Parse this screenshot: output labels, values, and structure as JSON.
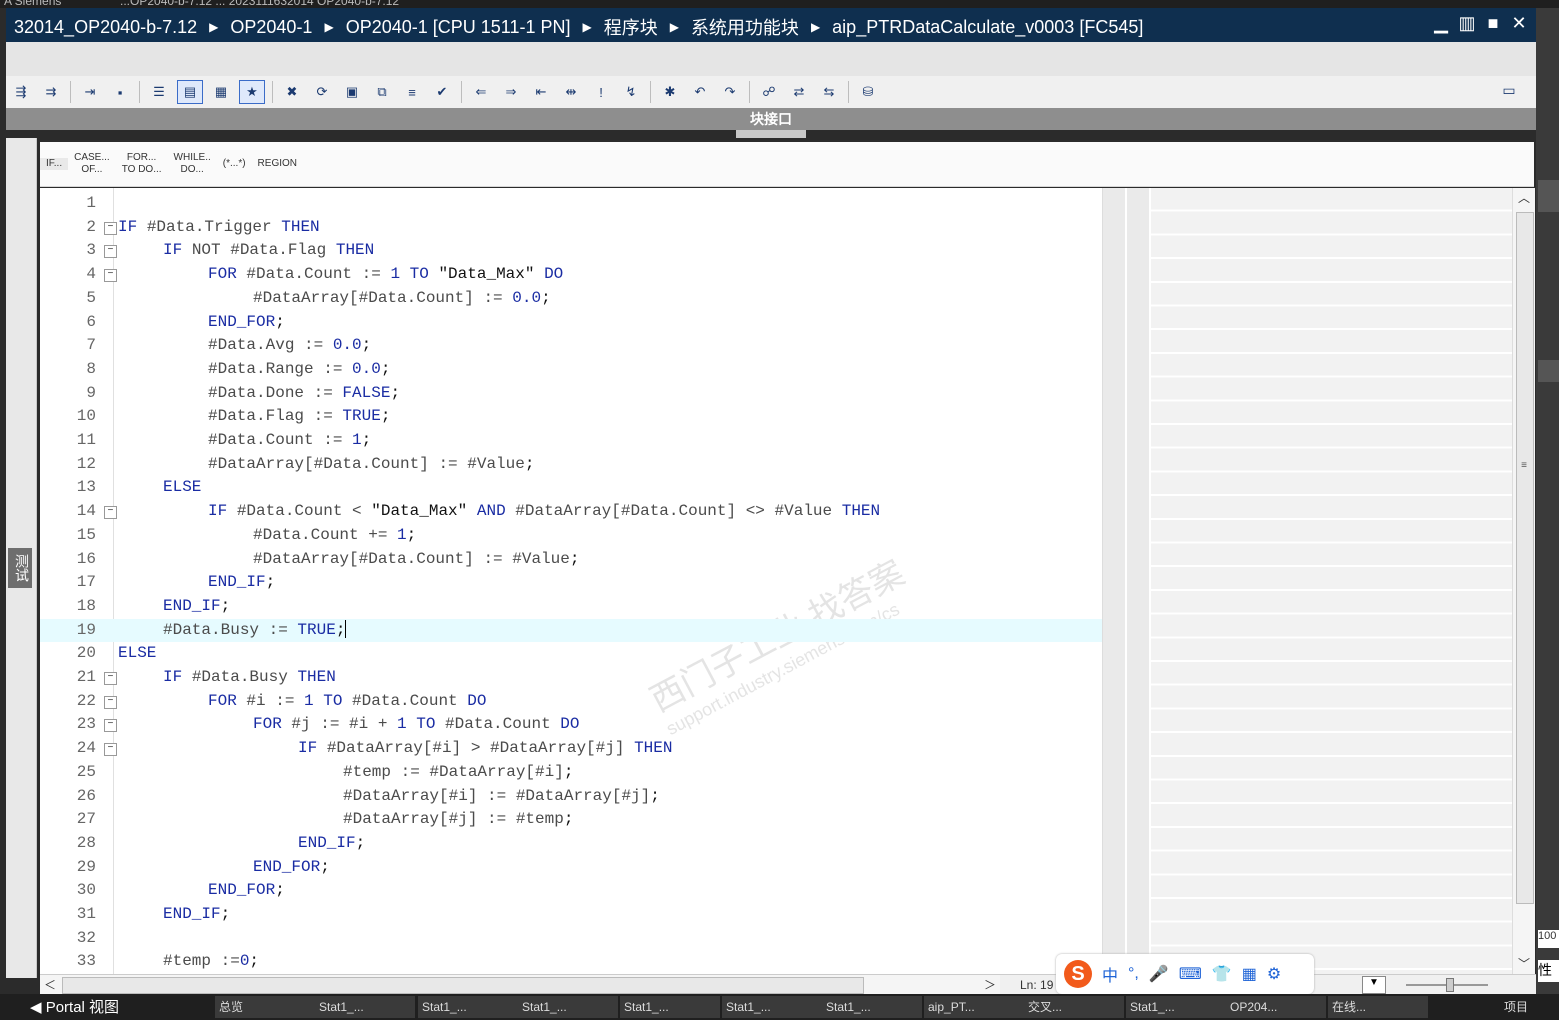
{
  "top_strip": {
    "left": "A Siemens",
    "middle": "...OP2040-b-7.12 ... 2023111632014 OP2040-b-7.12"
  },
  "breadcrumb": [
    "32014_OP2040-b-7.12",
    "OP2040-1",
    "OP2040-1 [CPU 1511-1 PN]",
    "程序块",
    "系统用功能块",
    "aip_PTRDataCalculate_v0003 [FC545]"
  ],
  "window_controls": [
    "minimize",
    "tile",
    "maximize",
    "close"
  ],
  "toolbar_icons": [
    "insert-network-icon",
    "delete-network-icon",
    "call-icon",
    "open-block-icon",
    "absolute-address-icon",
    "toggle-view-icon",
    "monitor-icon",
    "favorites-icon",
    "clear-breakpoint-icon",
    "set-breakpoint-icon",
    "step-icon",
    "run-icon",
    "comment-icon",
    "check-icon",
    "indent-left-icon",
    "indent-right-icon",
    "outdent-icon",
    "auto-format-icon",
    "line-comment-icon",
    "uncomment-icon",
    "bookmark-icon",
    "prev-bookmark-icon",
    "next-bookmark-icon",
    "diagnostics-icon",
    "go-to-icon",
    "go-back-icon",
    "settings-icon"
  ],
  "interface_label": "块接口",
  "snippets": [
    {
      "line1": "IF...",
      "line2": ""
    },
    {
      "line1": "CASE...",
      "line2": "OF..."
    },
    {
      "line1": "FOR...",
      "line2": "TO DO..."
    },
    {
      "line1": "WHILE..",
      "line2": "DO..."
    },
    {
      "line1": "(*...*)",
      "line2": ""
    },
    {
      "line1": "REGION",
      "line2": ""
    }
  ],
  "left_tab_label": "测试",
  "code_lines": [
    {
      "n": "1",
      "indent": 0,
      "fold": false,
      "tokens": []
    },
    {
      "n": "2",
      "indent": 0,
      "fold": true,
      "tokens": [
        [
          "kw",
          "IF "
        ],
        [
          "var",
          "#Data.Trigger "
        ],
        [
          "kw",
          "THEN"
        ]
      ]
    },
    {
      "n": "3",
      "indent": 1,
      "fold": true,
      "tokens": [
        [
          "kw",
          "IF "
        ],
        [
          "var",
          "NOT #Data.Flag "
        ],
        [
          "kw",
          "THEN"
        ]
      ]
    },
    {
      "n": "4",
      "indent": 2,
      "fold": true,
      "tokens": [
        [
          "kw",
          "FOR "
        ],
        [
          "var",
          "#Data.Count := "
        ],
        [
          "num",
          "1 "
        ],
        [
          "kw",
          "TO "
        ],
        [
          "str",
          "\"Data_Max\" "
        ],
        [
          "kw",
          "DO"
        ]
      ]
    },
    {
      "n": "5",
      "indent": 3,
      "fold": false,
      "tokens": [
        [
          "var",
          "#DataArray[#Data.Count] := "
        ],
        [
          "num",
          "0.0"
        ],
        [
          "str",
          ";"
        ]
      ]
    },
    {
      "n": "6",
      "indent": 2,
      "fold": false,
      "tokens": [
        [
          "kw",
          "END_FOR"
        ],
        [
          "str",
          ";"
        ]
      ]
    },
    {
      "n": "7",
      "indent": 2,
      "fold": false,
      "tokens": [
        [
          "var",
          "#Data.Avg := "
        ],
        [
          "num",
          "0.0"
        ],
        [
          "str",
          ";"
        ]
      ]
    },
    {
      "n": "8",
      "indent": 2,
      "fold": false,
      "tokens": [
        [
          "var",
          "#Data.Range := "
        ],
        [
          "num",
          "0.0"
        ],
        [
          "str",
          ";"
        ]
      ]
    },
    {
      "n": "9",
      "indent": 2,
      "fold": false,
      "tokens": [
        [
          "var",
          "#Data.Done := "
        ],
        [
          "kw",
          "FALSE"
        ],
        [
          "str",
          ";"
        ]
      ]
    },
    {
      "n": "10",
      "indent": 2,
      "fold": false,
      "tokens": [
        [
          "var",
          "#Data.Flag := "
        ],
        [
          "kw",
          "TRUE"
        ],
        [
          "str",
          ";"
        ]
      ]
    },
    {
      "n": "11",
      "indent": 2,
      "fold": false,
      "tokens": [
        [
          "var",
          "#Data.Count := "
        ],
        [
          "num",
          "1"
        ],
        [
          "str",
          ";"
        ]
      ]
    },
    {
      "n": "12",
      "indent": 2,
      "fold": false,
      "tokens": [
        [
          "var",
          "#DataArray[#Data.Count] := #Value"
        ],
        [
          "str",
          ";"
        ]
      ]
    },
    {
      "n": "13",
      "indent": 1,
      "fold": false,
      "tokens": [
        [
          "kw",
          "ELSE"
        ]
      ]
    },
    {
      "n": "14",
      "indent": 2,
      "fold": true,
      "tokens": [
        [
          "kw",
          "IF "
        ],
        [
          "var",
          "#Data.Count < "
        ],
        [
          "str",
          "\"Data_Max\" "
        ],
        [
          "kw",
          "AND "
        ],
        [
          "var",
          "#DataArray[#Data.Count] <> #Value "
        ],
        [
          "kw",
          "THEN"
        ]
      ]
    },
    {
      "n": "15",
      "indent": 3,
      "fold": false,
      "tokens": [
        [
          "var",
          "#Data.Count += "
        ],
        [
          "num",
          "1"
        ],
        [
          "str",
          ";"
        ]
      ]
    },
    {
      "n": "16",
      "indent": 3,
      "fold": false,
      "tokens": [
        [
          "var",
          "#DataArray[#Data.Count] := #Value"
        ],
        [
          "str",
          ";"
        ]
      ]
    },
    {
      "n": "17",
      "indent": 2,
      "fold": false,
      "tokens": [
        [
          "kw",
          "END_IF"
        ],
        [
          "str",
          ";"
        ]
      ]
    },
    {
      "n": "18",
      "indent": 1,
      "fold": false,
      "tokens": [
        [
          "kw",
          "END_IF"
        ],
        [
          "str",
          ";"
        ]
      ]
    },
    {
      "n": "19",
      "indent": 1,
      "fold": false,
      "current": true,
      "tokens": [
        [
          "var",
          "#Data.Busy := "
        ],
        [
          "kw",
          "TRUE"
        ],
        [
          "str",
          ";"
        ]
      ]
    },
    {
      "n": "20",
      "indent": 0,
      "fold": false,
      "tokens": [
        [
          "kw",
          "ELSE"
        ]
      ]
    },
    {
      "n": "21",
      "indent": 1,
      "fold": true,
      "tokens": [
        [
          "kw",
          "IF "
        ],
        [
          "var",
          "#Data.Busy "
        ],
        [
          "kw",
          "THEN"
        ]
      ]
    },
    {
      "n": "22",
      "indent": 2,
      "fold": true,
      "tokens": [
        [
          "kw",
          "FOR "
        ],
        [
          "var",
          "#i := "
        ],
        [
          "num",
          "1 "
        ],
        [
          "kw",
          "TO "
        ],
        [
          "var",
          "#Data.Count "
        ],
        [
          "kw",
          "DO"
        ]
      ]
    },
    {
      "n": "23",
      "indent": 3,
      "fold": true,
      "tokens": [
        [
          "kw",
          "FOR "
        ],
        [
          "var",
          "#j := #i + "
        ],
        [
          "num",
          "1 "
        ],
        [
          "kw",
          "TO "
        ],
        [
          "var",
          "#Data.Count "
        ],
        [
          "kw",
          "DO"
        ]
      ]
    },
    {
      "n": "24",
      "indent": 4,
      "fold": true,
      "tokens": [
        [
          "kw",
          "IF "
        ],
        [
          "var",
          "#DataArray[#i] > #DataArray[#j] "
        ],
        [
          "kw",
          "THEN"
        ]
      ]
    },
    {
      "n": "25",
      "indent": 5,
      "fold": false,
      "tokens": [
        [
          "var",
          "#temp := #DataArray[#i]"
        ],
        [
          "str",
          ";"
        ]
      ]
    },
    {
      "n": "26",
      "indent": 5,
      "fold": false,
      "tokens": [
        [
          "var",
          "#DataArray[#i] := #DataArray[#j]"
        ],
        [
          "str",
          ";"
        ]
      ]
    },
    {
      "n": "27",
      "indent": 5,
      "fold": false,
      "tokens": [
        [
          "var",
          "#DataArray[#j] := #temp"
        ],
        [
          "str",
          ";"
        ]
      ]
    },
    {
      "n": "28",
      "indent": 4,
      "fold": false,
      "tokens": [
        [
          "kw",
          "END_IF"
        ],
        [
          "str",
          ";"
        ]
      ]
    },
    {
      "n": "29",
      "indent": 3,
      "fold": false,
      "tokens": [
        [
          "kw",
          "END_FOR"
        ],
        [
          "str",
          ";"
        ]
      ]
    },
    {
      "n": "30",
      "indent": 2,
      "fold": false,
      "tokens": [
        [
          "kw",
          "END_FOR"
        ],
        [
          "str",
          ";"
        ]
      ]
    },
    {
      "n": "31",
      "indent": 1,
      "fold": false,
      "tokens": [
        [
          "kw",
          "END_IF"
        ],
        [
          "str",
          ";"
        ]
      ]
    },
    {
      "n": "32",
      "indent": 0,
      "fold": false,
      "tokens": []
    },
    {
      "n": "33",
      "indent": 1,
      "fold": false,
      "tokens": [
        [
          "var",
          "#temp :="
        ],
        [
          "num",
          "0"
        ],
        [
          "str",
          ";"
        ]
      ]
    }
  ],
  "watermark": {
    "line1": "西门子工业  找答案",
    "line2": "support.industry.siemens.com/cs"
  },
  "status": {
    "ln": "Ln: 19"
  },
  "ime": {
    "logo": "S",
    "items": [
      "中",
      "°,",
      "🎤",
      "⌨",
      "👕",
      "▦",
      "⚙"
    ]
  },
  "right_edge": {
    "zoom": "100",
    "prop": "性"
  },
  "taskbar": {
    "portal": "◀ Portal 视图",
    "items": [
      "总览",
      "Stat1_...",
      "Stat1_...",
      "Stat1_...",
      "Stat1_...",
      "Stat1_...",
      "Stat1_...",
      "aip_PT...",
      "交叉...",
      "Stat1_...",
      "OP204...",
      "在线..."
    ],
    "right": "项目"
  }
}
